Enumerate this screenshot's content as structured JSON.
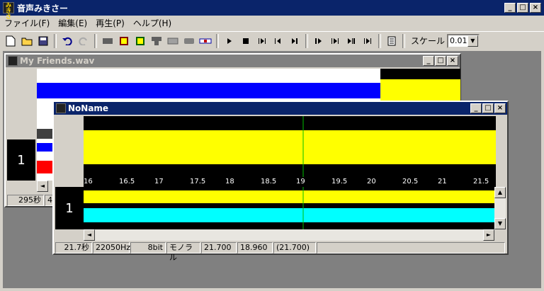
{
  "app": {
    "title": "音声みきさー"
  },
  "menu": [
    "ファイル(F)",
    "編集(E)",
    "再生(P)",
    "ヘルプ(H)"
  ],
  "toolbar": {
    "scale_label": "スケール",
    "scale_value": "0.01"
  },
  "window1": {
    "title": "My Friends.wav",
    "track": "1",
    "status": [
      "295秒",
      "44"
    ]
  },
  "window2": {
    "title": "NoName",
    "track": "1",
    "ruler": [
      "16",
      "16.5",
      "17",
      "17.5",
      "18",
      "18.5",
      "19",
      "19.5",
      "20",
      "20.5",
      "21",
      "21.5"
    ],
    "status": [
      "21.7秒",
      "22050Hz",
      "8bit",
      "モノラル",
      "21.700",
      "18.960",
      "(21.700)"
    ]
  },
  "colors": {
    "wave_blue": "#0000ff",
    "wave_yellow": "#ffff00",
    "cyan": "#00ffff",
    "titlebar": "#0a246a"
  }
}
